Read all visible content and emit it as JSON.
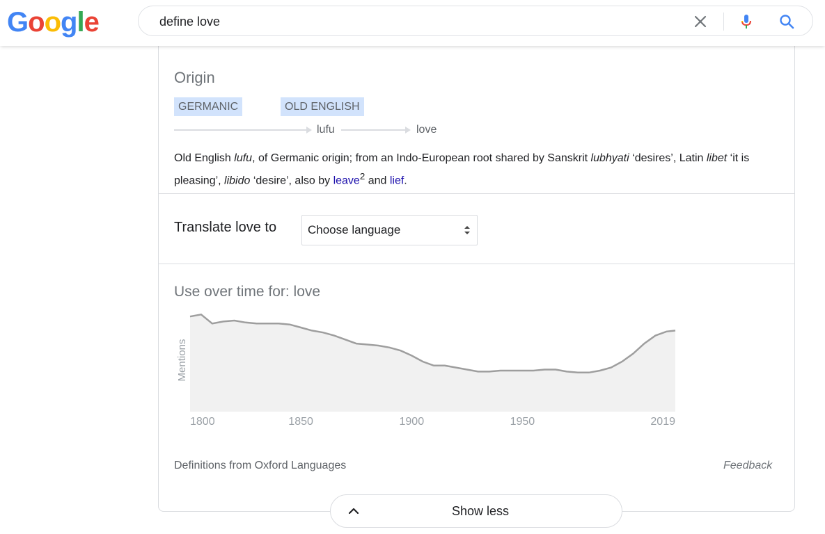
{
  "header": {
    "logo_letters": [
      {
        "ch": "G",
        "color": "#4285F4"
      },
      {
        "ch": "o",
        "color": "#EA4335"
      },
      {
        "ch": "o",
        "color": "#FBBC05"
      },
      {
        "ch": "g",
        "color": "#4285F4"
      },
      {
        "ch": "l",
        "color": "#34A853"
      },
      {
        "ch": "e",
        "color": "#EA4335"
      }
    ],
    "search": {
      "value": "define love"
    },
    "icons": {
      "clear": "close-icon",
      "mic": "microphone-icon",
      "search": "search-icon"
    }
  },
  "origin": {
    "title": "Origin",
    "tags": [
      "GERMANIC",
      "OLD ENGLISH"
    ],
    "words": [
      "lufu",
      "love"
    ],
    "text_parts": [
      {
        "t": "Old English ",
        "style": "normal"
      },
      {
        "t": "lufu",
        "style": "italic"
      },
      {
        "t": ", of Germanic origin; from an Indo-European root shared by Sanskrit ",
        "style": "normal"
      },
      {
        "t": "lubhyati",
        "style": "italic"
      },
      {
        "t": " ‘desires’, Latin ",
        "style": "normal"
      },
      {
        "t": "libet",
        "style": "italic"
      },
      {
        "t": " ‘it is pleasing’, ",
        "style": "normal"
      },
      {
        "t": "libido",
        "style": "italic"
      },
      {
        "t": " ‘desire’, also by ",
        "style": "normal"
      },
      {
        "t": "leave",
        "style": "link"
      },
      {
        "t": "2",
        "style": "sup"
      },
      {
        "t": " and ",
        "style": "normal"
      },
      {
        "t": "lief",
        "style": "link"
      },
      {
        "t": ".",
        "style": "normal"
      }
    ]
  },
  "translate": {
    "label": "Translate love to",
    "select_value": "Choose language"
  },
  "usage": {
    "title": "Use over time for: love"
  },
  "chart_data": {
    "type": "area",
    "title": "Use over time for: love",
    "ylabel": "Mentions",
    "xlabel": "",
    "x_ticks": [
      "1800",
      "1850",
      "1900",
      "1950",
      "2019"
    ],
    "xlim": [
      1800,
      2019
    ],
    "ylim": [
      0,
      100
    ],
    "series": [
      {
        "x": [
          1800,
          1805,
          1810,
          1815,
          1820,
          1825,
          1830,
          1835,
          1840,
          1845,
          1850,
          1855,
          1860,
          1865,
          1870,
          1875,
          1880,
          1885,
          1890,
          1895,
          1900,
          1905,
          1910,
          1915,
          1920,
          1925,
          1930,
          1935,
          1940,
          1945,
          1950,
          1955,
          1960,
          1965,
          1970,
          1975,
          1980,
          1985,
          1990,
          1995,
          2000,
          2005,
          2010,
          2015,
          2019
        ],
        "y": [
          95,
          97,
          88,
          90,
          91,
          89,
          88,
          88,
          88,
          87,
          84,
          81,
          79,
          76,
          72,
          68,
          67,
          66,
          64,
          61,
          56,
          50,
          46,
          46,
          44,
          42,
          40,
          40,
          41,
          41,
          41,
          41,
          42,
          42,
          40,
          39,
          39,
          41,
          44,
          50,
          58,
          68,
          76,
          80,
          81
        ]
      }
    ],
    "grid": false,
    "fill_color": "#f1f1f1",
    "line_color": "#9e9e9e"
  },
  "footer": {
    "source": "Definitions from Oxford Languages",
    "feedback": "Feedback",
    "show_less": "Show less"
  },
  "colors": {
    "link": "#1a0dab",
    "tag_bg": "#d2e3fc",
    "muted": "#70757a"
  }
}
